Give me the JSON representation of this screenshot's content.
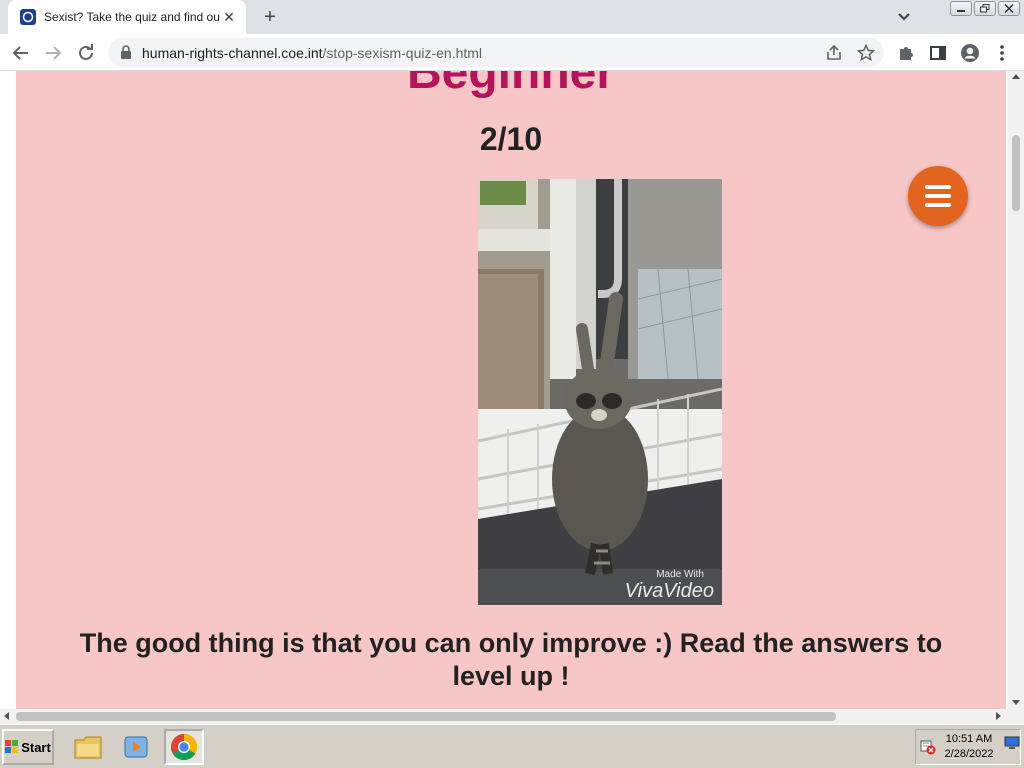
{
  "browser": {
    "tab": {
      "title": "Sexist? Take the quiz and find out!",
      "favicon": "coe-favicon-icon"
    },
    "url": {
      "host": "human-rights-channel.coe.int",
      "path": "/stop-sexism-quiz-en.html"
    }
  },
  "page": {
    "level_title": "Beginner",
    "counter": "2/10",
    "gif_caption": {
      "line1": "Made With",
      "line2": "VivaVideo"
    },
    "answer_text": "The good thing is that you can only improve :) Read the answers to level up !",
    "colors": {
      "background": "#f7c6c6",
      "title": "#b5135a",
      "menu_button": "#e3641f"
    }
  },
  "taskbar": {
    "start_label": "Start",
    "clock_time": "10:51 AM",
    "clock_date": "2/28/2022"
  }
}
